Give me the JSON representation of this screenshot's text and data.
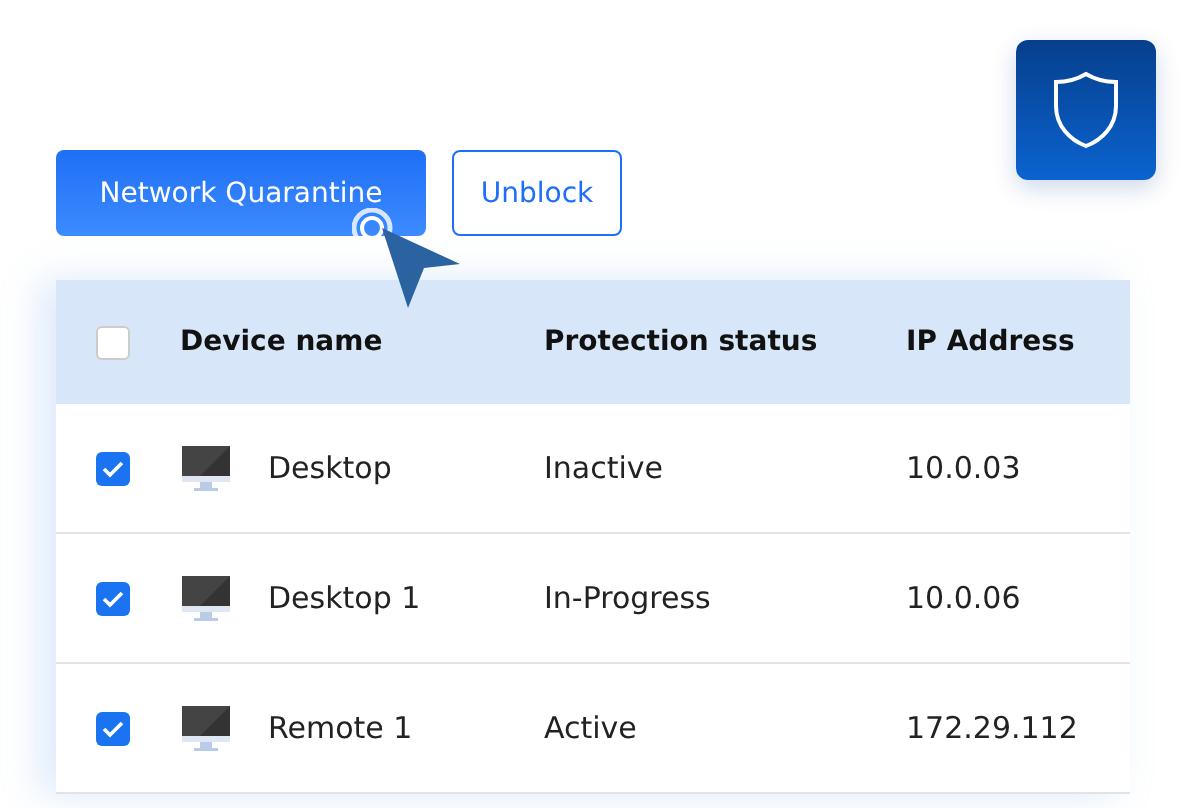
{
  "toolbar": {
    "buttons": [
      {
        "label": "Network Quarantine",
        "kind": "primary"
      },
      {
        "label": "Unblock",
        "kind": "outline"
      }
    ]
  },
  "table": {
    "select_all": {
      "checked": false
    },
    "columns": [
      "Device name",
      "Protection status",
      "IP Address"
    ],
    "rows": [
      {
        "checked": true,
        "device": "Desktop",
        "status": "Inactive",
        "ip": "10.0.03"
      },
      {
        "checked": true,
        "device": "Desktop 1",
        "status": "In-Progress",
        "ip": "10.0.06"
      },
      {
        "checked": true,
        "device": "Remote 1",
        "status": "Active",
        "ip": "172.29.112"
      }
    ]
  }
}
